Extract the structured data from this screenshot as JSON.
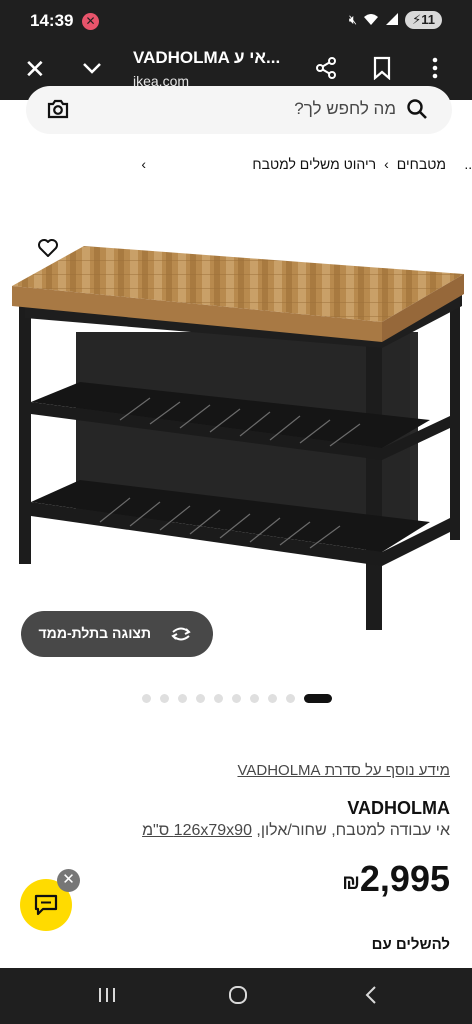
{
  "status_bar": {
    "time": "14:39",
    "battery": "11"
  },
  "browser": {
    "title": "VADHOLMA אי ע...",
    "url": "ikea.com"
  },
  "search": {
    "placeholder": "מה לחפש לך?"
  },
  "breadcrumb": {
    "ellipsis": "...",
    "items": [
      "מטבחים",
      "ריהוט משלים למטבח"
    ],
    "separator": "›"
  },
  "view_3d_button": {
    "label": "תצוגה בתלת-ממד"
  },
  "carousel": {
    "total_dots": 10,
    "active_index": 9
  },
  "product": {
    "series_link": "מידע נוסף על סדרת VADHOLMA",
    "name": "VADHOLMA",
    "description": "אי עבודה למטבח, שחור/אלון,",
    "dimensions": "126x79x90 ס\"מ",
    "price": "2,995",
    "currency": "₪",
    "complete_heading": "להשלים עם"
  },
  "colors": {
    "chat_button": "#ffdb00",
    "top_bars": "#1f1f1f",
    "button_dark": "#484848"
  }
}
